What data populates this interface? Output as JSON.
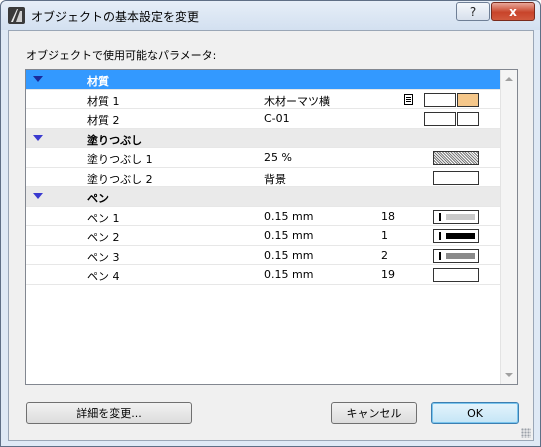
{
  "window": {
    "title": "オブジェクトの基本設定を変更",
    "help_label": "?",
    "close_label": "x"
  },
  "list_label": "オブジェクトで使用可能なパラメータ:",
  "groups": [
    {
      "label": "材質",
      "selected": true,
      "rows": [
        {
          "name": "材質 1",
          "value": "木材ーマツ横",
          "has_doc_icon": true,
          "swatch": "material-white-tan"
        },
        {
          "name": "材質 2",
          "value": "C-01",
          "swatch": "material-white-white"
        }
      ]
    },
    {
      "label": "塗りつぶし",
      "rows": [
        {
          "name": "塗りつぶし 1",
          "value": "25 %",
          "swatch": "fill-25"
        },
        {
          "name": "塗りつぶし 2",
          "value": "背景",
          "swatch": "fill-empty"
        }
      ]
    },
    {
      "label": "ペン",
      "rows": [
        {
          "name": "ペン 1",
          "value": "0.15 mm",
          "number": "18",
          "swatch": "pen-lightgray"
        },
        {
          "name": "ペン 2",
          "value": "0.15 mm",
          "number": "1",
          "swatch": "pen-black"
        },
        {
          "name": "ペン 3",
          "value": "0.15 mm",
          "number": "2",
          "swatch": "pen-gray"
        },
        {
          "name": "ペン 4",
          "value": "0.15 mm",
          "number": "19",
          "swatch": "pen-empty"
        }
      ]
    }
  ],
  "buttons": {
    "details": "詳細を変更...",
    "cancel": "キャンセル",
    "ok": "OK"
  },
  "colors": {
    "selection": "#3399ff",
    "tan_swatch": "#f5c78a",
    "group_triangle": "#3a3ad0"
  }
}
